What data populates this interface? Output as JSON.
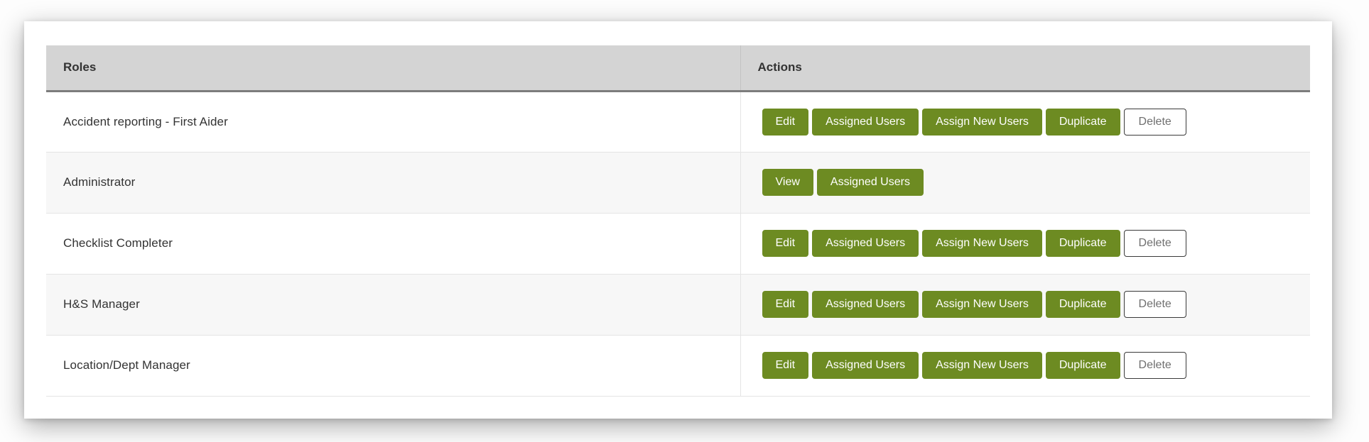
{
  "colors": {
    "primary_button": "#6d8b22",
    "header_background": "#d4d4d4",
    "header_rule": "#7c7c7c",
    "row_stripe": "#f7f7f7",
    "outline_button_border": "#3a3a3a",
    "outline_button_text": "#6f6f6f"
  },
  "table": {
    "columns": [
      {
        "key": "roles",
        "label": "Roles"
      },
      {
        "key": "actions",
        "label": "Actions"
      }
    ],
    "rows": [
      {
        "role": "Accident reporting - First Aider",
        "actions": [
          {
            "label": "Edit",
            "style": "primary"
          },
          {
            "label": "Assigned Users",
            "style": "primary"
          },
          {
            "label": "Assign New Users",
            "style": "primary"
          },
          {
            "label": "Duplicate",
            "style": "primary"
          },
          {
            "label": "Delete",
            "style": "outline"
          }
        ]
      },
      {
        "role": "Administrator",
        "actions": [
          {
            "label": "View",
            "style": "primary"
          },
          {
            "label": "Assigned Users",
            "style": "primary"
          }
        ]
      },
      {
        "role": "Checklist Completer",
        "actions": [
          {
            "label": "Edit",
            "style": "primary"
          },
          {
            "label": "Assigned Users",
            "style": "primary"
          },
          {
            "label": "Assign New Users",
            "style": "primary"
          },
          {
            "label": "Duplicate",
            "style": "primary"
          },
          {
            "label": "Delete",
            "style": "outline"
          }
        ]
      },
      {
        "role": "H&S Manager",
        "actions": [
          {
            "label": "Edit",
            "style": "primary"
          },
          {
            "label": "Assigned Users",
            "style": "primary"
          },
          {
            "label": "Assign New Users",
            "style": "primary"
          },
          {
            "label": "Duplicate",
            "style": "primary"
          },
          {
            "label": "Delete",
            "style": "outline"
          }
        ]
      },
      {
        "role": "Location/Dept Manager",
        "actions": [
          {
            "label": "Edit",
            "style": "primary"
          },
          {
            "label": "Assigned Users",
            "style": "primary"
          },
          {
            "label": "Assign New Users",
            "style": "primary"
          },
          {
            "label": "Duplicate",
            "style": "primary"
          },
          {
            "label": "Delete",
            "style": "outline"
          }
        ]
      }
    ]
  }
}
